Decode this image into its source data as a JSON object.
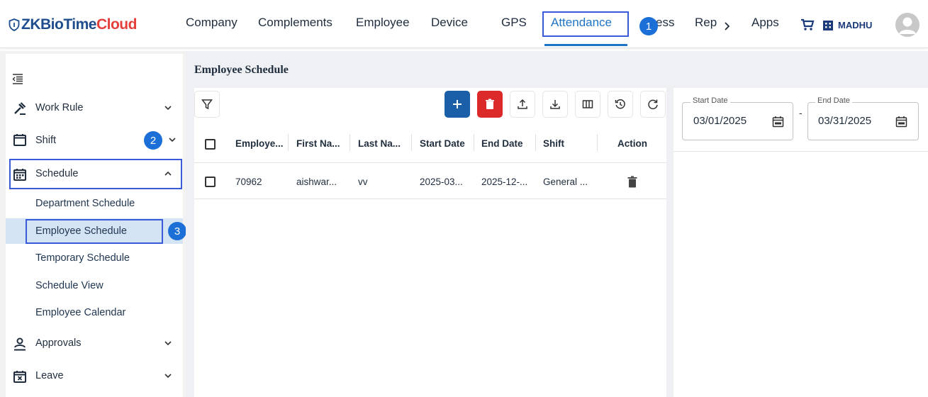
{
  "header": {
    "logo_part1": "ZKBioTime",
    "logo_part2": "Cloud",
    "nav": [
      "Company",
      "Complements",
      "Employee",
      "Device",
      "GPS",
      "Attendance",
      "ess",
      "Rep",
      "Apps"
    ],
    "user": "MADHU"
  },
  "callouts": [
    "1",
    "2",
    "3"
  ],
  "sidebar": {
    "items": [
      {
        "label": "Work Rule",
        "icon": "gavel-icon"
      },
      {
        "label": "Shift",
        "icon": "calendar-icon"
      },
      {
        "label": "Schedule",
        "icon": "calendar-grid-icon"
      },
      {
        "label": "Approvals",
        "icon": "user-approve-icon"
      },
      {
        "label": "Leave",
        "icon": "calendar-x-icon"
      }
    ],
    "sub_items": [
      "Department Schedule",
      "Employee Schedule",
      "Temporary Schedule",
      "Schedule View",
      "Employee Calendar"
    ]
  },
  "page": {
    "title": "Employee Schedule"
  },
  "table": {
    "columns": [
      "Employe...",
      "First Na...",
      "Last Na...",
      "Start Date",
      "End Date",
      "Shift",
      "Action"
    ],
    "rows": [
      [
        "70962",
        "aishwar...",
        "vv",
        "2025-03...",
        "2025-12-...",
        "General ..."
      ]
    ]
  },
  "filters": {
    "start_label": "Start Date",
    "start_value": "03/01/2025",
    "end_label": "End Date",
    "end_value": "03/31/2025",
    "separator": "-"
  },
  "colors": {
    "accent": "#1f74c6",
    "brand_blue": "#1e4c8c",
    "brand_red": "#e33f3b",
    "primary_button": "#1b5fa8",
    "danger_button": "#dc2a2a",
    "callout": "#1b6fd6",
    "highlight_box": "#3a5bd9"
  }
}
